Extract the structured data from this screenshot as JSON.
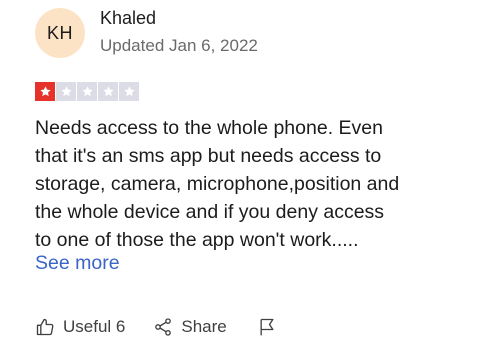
{
  "reviewer": {
    "initials": "KH",
    "name": "Khaled",
    "date": "Updated Jan 6, 2022"
  },
  "rating": {
    "value": 1,
    "max": 5,
    "filled_color": "#e5322b",
    "empty_color": "#dcdce6"
  },
  "review": {
    "text": "Needs access to the whole phone. Even\nthat it's an sms app but needs access to\nstorage, camera, microphone,position and\nthe whole device and if you deny access\nto one of those the app won't work.....",
    "see_more": "See more"
  },
  "actions": {
    "useful_label": "Useful 6",
    "share_label": "Share",
    "useful_icon": "thumbs-up-icon",
    "share_icon": "share-icon",
    "flag_icon": "flag-icon"
  },
  "colors": {
    "avatar_bg": "#fde3c6",
    "link": "#3a64c8"
  }
}
